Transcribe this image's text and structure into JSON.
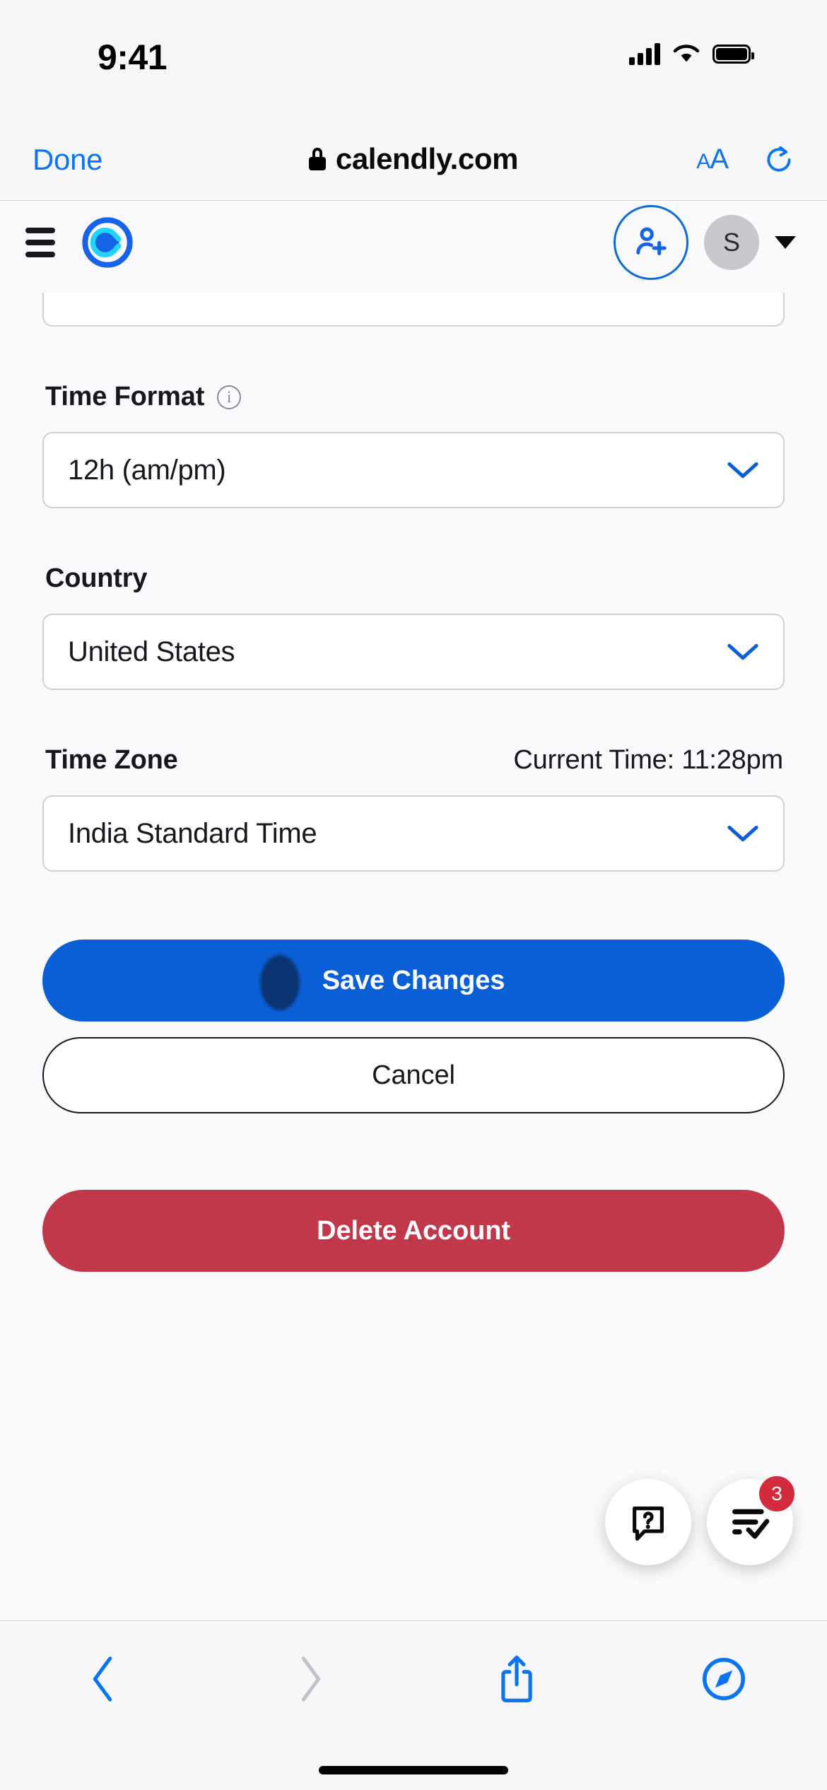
{
  "status_bar": {
    "time": "9:41",
    "cellular_icon": "cellular-signal-icon",
    "wifi_icon": "wifi-icon",
    "battery_icon": "battery-full-icon"
  },
  "browser": {
    "done_label": "Done",
    "url": "calendly.com",
    "lock_icon": "lock-icon",
    "text_size_label": "AA",
    "reload_icon": "reload-icon",
    "toolbar": {
      "back_icon": "chevron-left-icon",
      "forward_icon": "chevron-right-icon",
      "share_icon": "share-icon",
      "tabs_icon": "safari-compass-icon"
    }
  },
  "app_header": {
    "menu_icon": "hamburger-menu-icon",
    "logo_icon": "calendly-logo-icon",
    "invite_icon": "add-user-icon",
    "avatar_initial": "S",
    "account_caret_icon": "caret-down-icon"
  },
  "form": {
    "time_format": {
      "label": "Time Format",
      "info_icon": "info-circle-icon",
      "value": "12h (am/pm)",
      "chevron_icon": "chevron-down-icon"
    },
    "country": {
      "label": "Country",
      "value": "United States",
      "chevron_icon": "chevron-down-icon"
    },
    "time_zone": {
      "label": "Time Zone",
      "current_time_label": "Current Time:  11:28pm",
      "value": "India Standard Time",
      "chevron_icon": "chevron-down-icon"
    },
    "save_label": "Save Changes",
    "cancel_label": "Cancel",
    "delete_label": "Delete Account"
  },
  "fabs": {
    "help_icon": "help-chat-bubble-icon",
    "tasks_icon": "checklist-icon",
    "tasks_badge": "3"
  },
  "colors": {
    "accent_blue": "#0B5FD6",
    "link_blue": "#0B74F0",
    "danger_red": "#C0384A",
    "badge_red": "#D32B3E",
    "page_bg": "#FAFAFC"
  }
}
